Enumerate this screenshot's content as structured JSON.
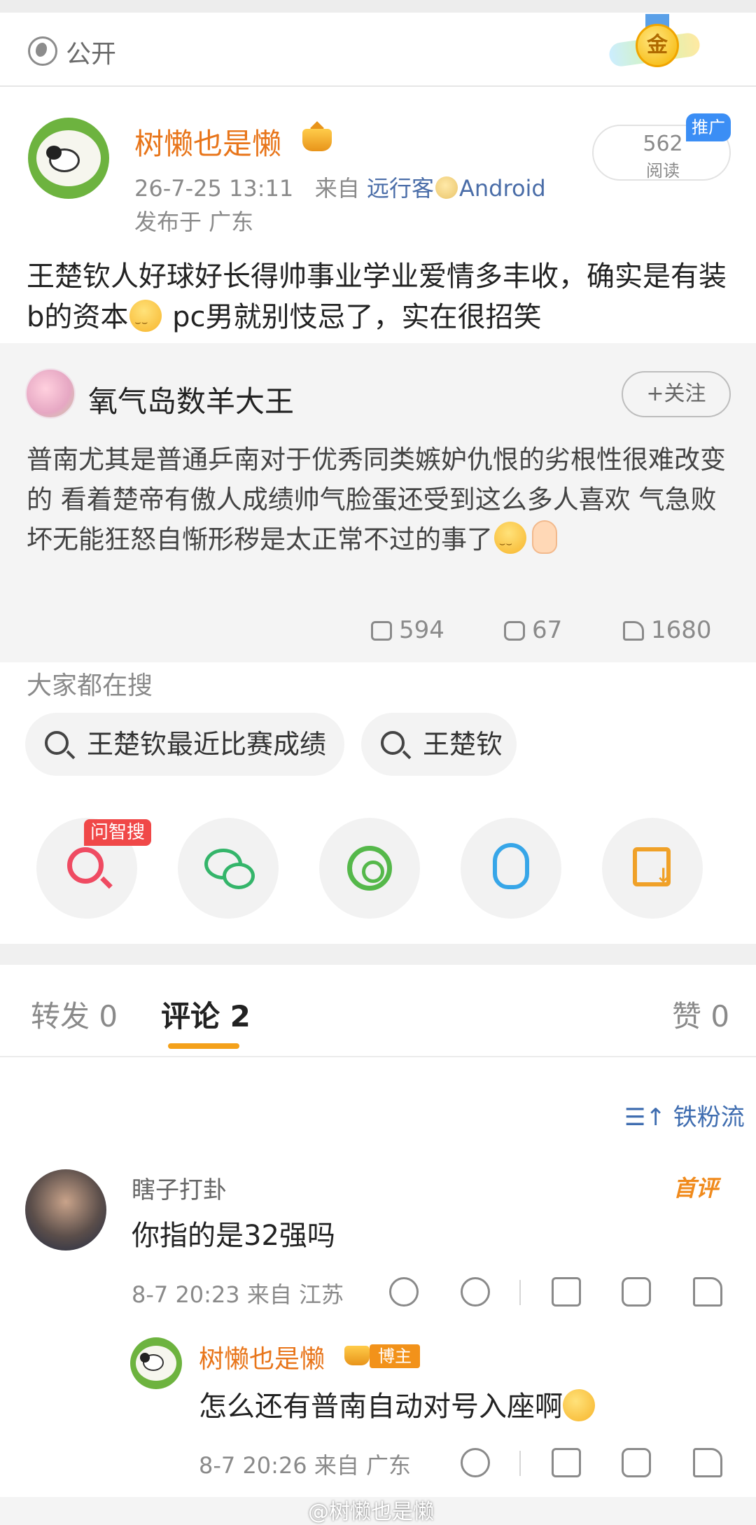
{
  "visibility": {
    "label": "公开",
    "icon": "globe-icon"
  },
  "post": {
    "author": "树懒也是懒",
    "time": "26-7-25 13:11",
    "source_prefix": "来自",
    "source_app": "远行客",
    "source_device": "Android",
    "location": "发布于 广东",
    "read_count": "562",
    "read_label": "阅读",
    "promo_label": "推广",
    "text_part1": "王楚钦人好球好长得帅事业学业爱情多丰收，确实是有装b的资本",
    "text_part2": " pc男就别忮忌了，实在很招笑"
  },
  "quoted": {
    "author": "氧气岛数羊大王",
    "follow_label": "+关注",
    "text": "普南尤其是普通乒南对于优秀同类嫉妒仇恨的劣根性很难改变的 看着楚帝有傲人成绩帅气脸蛋还受到这么多人喜欢 气急败坏无能狂怒自惭形秽是太正常不过的事了",
    "reposts": "594",
    "comments": "67",
    "likes": "1680"
  },
  "hot_search": {
    "title": "大家都在搜",
    "chips": [
      "王楚钦最近比赛成绩",
      "王楚钦"
    ]
  },
  "share": {
    "ask_badge": "问智搜",
    "icons": [
      "ask-search-icon",
      "wechat-icon",
      "moments-icon",
      "qq-icon",
      "save-image-icon"
    ]
  },
  "tabs": {
    "repost": "转发 0",
    "comment": "评论 2",
    "like": "赞 0"
  },
  "sort_label": "铁粉流",
  "comments": [
    {
      "name": "瞎子打卦",
      "badge": "首评",
      "text": "你指的是32强吗",
      "meta": "8-7 20:23  来自 江苏"
    }
  ],
  "reply": {
    "name": "树懒也是懒",
    "host_badge": "博主",
    "text": "怎么还有普南自动对号入座啊",
    "meta": "8-7 20:26  来自 广东"
  },
  "watermark": "@树懒也是懒",
  "colors": {
    "accent": "#f4a11b",
    "author": "#e8751a",
    "link": "#4a6da8",
    "promo": "#3b8ef5"
  }
}
